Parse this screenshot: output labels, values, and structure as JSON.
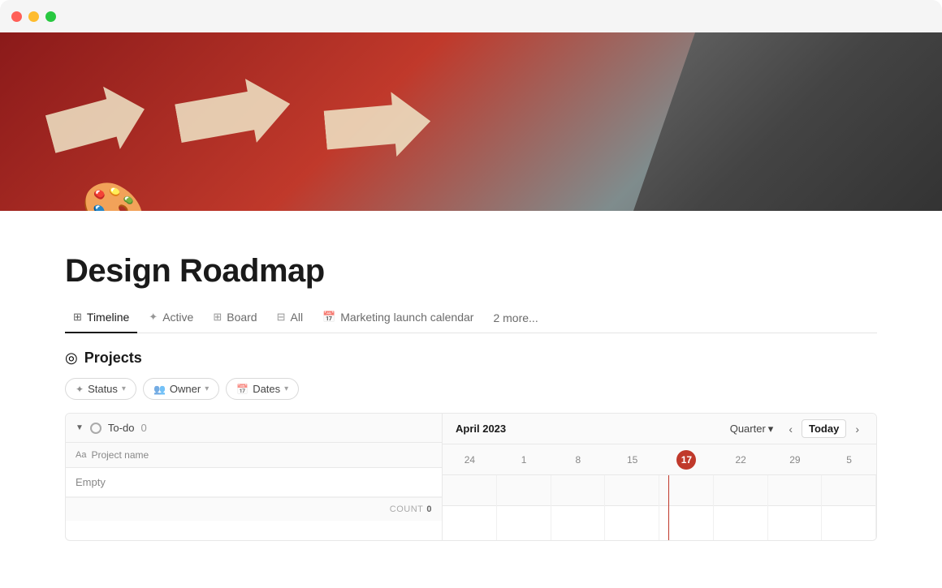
{
  "titlebar": {
    "buttons": [
      "close",
      "minimize",
      "maximize"
    ]
  },
  "hero": {
    "emoji": "🎨"
  },
  "page": {
    "title": "Design Roadmap"
  },
  "tabs": [
    {
      "id": "timeline",
      "label": "Timeline",
      "icon": "⊞",
      "active": true
    },
    {
      "id": "active",
      "label": "Active",
      "icon": "✦",
      "active": false
    },
    {
      "id": "board",
      "label": "Board",
      "icon": "⊞",
      "active": false
    },
    {
      "id": "all",
      "label": "All",
      "icon": "⊟",
      "active": false
    },
    {
      "id": "marketing",
      "label": "Marketing launch calendar",
      "icon": "📅",
      "active": false
    }
  ],
  "tabs_more_label": "2 more...",
  "section": {
    "icon": "◎",
    "title": "Projects"
  },
  "filters": [
    {
      "id": "status",
      "label": "Status",
      "icon": "✦"
    },
    {
      "id": "owner",
      "label": "Owner",
      "icon": "👥"
    },
    {
      "id": "dates",
      "label": "Dates",
      "icon": "📅"
    }
  ],
  "table": {
    "group": {
      "label": "To-do",
      "count": "0"
    },
    "column_header": {
      "icon": "Aa",
      "label": "Project name"
    },
    "empty_row_label": "Empty",
    "count_label": "COUNT",
    "count_value": "0"
  },
  "timeline": {
    "month_label": "April 2023",
    "dates": [
      "24",
      "1",
      "8",
      "15",
      "17",
      "22",
      "29",
      "5"
    ],
    "today_date": "17",
    "quarter_label": "Quarter",
    "today_btn_label": "Today"
  }
}
